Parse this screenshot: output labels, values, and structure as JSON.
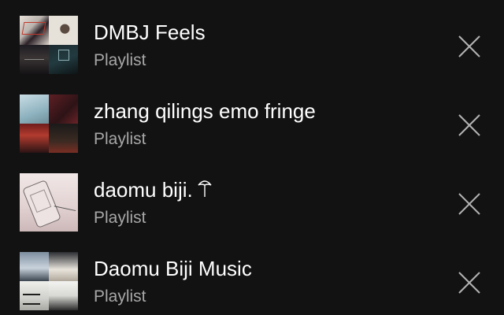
{
  "items": [
    {
      "title": "DMBJ Feels",
      "subtitle": "Playlist",
      "remove_icon": "close-icon"
    },
    {
      "title": "zhang qilings emo fringe",
      "subtitle": "Playlist",
      "remove_icon": "close-icon"
    },
    {
      "title": "daomu biji.",
      "subtitle": "Playlist",
      "title_icon": "umbrella-icon",
      "remove_icon": "close-icon"
    },
    {
      "title": "Daomu Biji Music",
      "subtitle": "Playlist",
      "remove_icon": "close-icon"
    }
  ],
  "colors": {
    "background": "#121212",
    "title": "#ffffff",
    "subtitle": "#a7a7a7",
    "icon": "#b3b3b3"
  }
}
